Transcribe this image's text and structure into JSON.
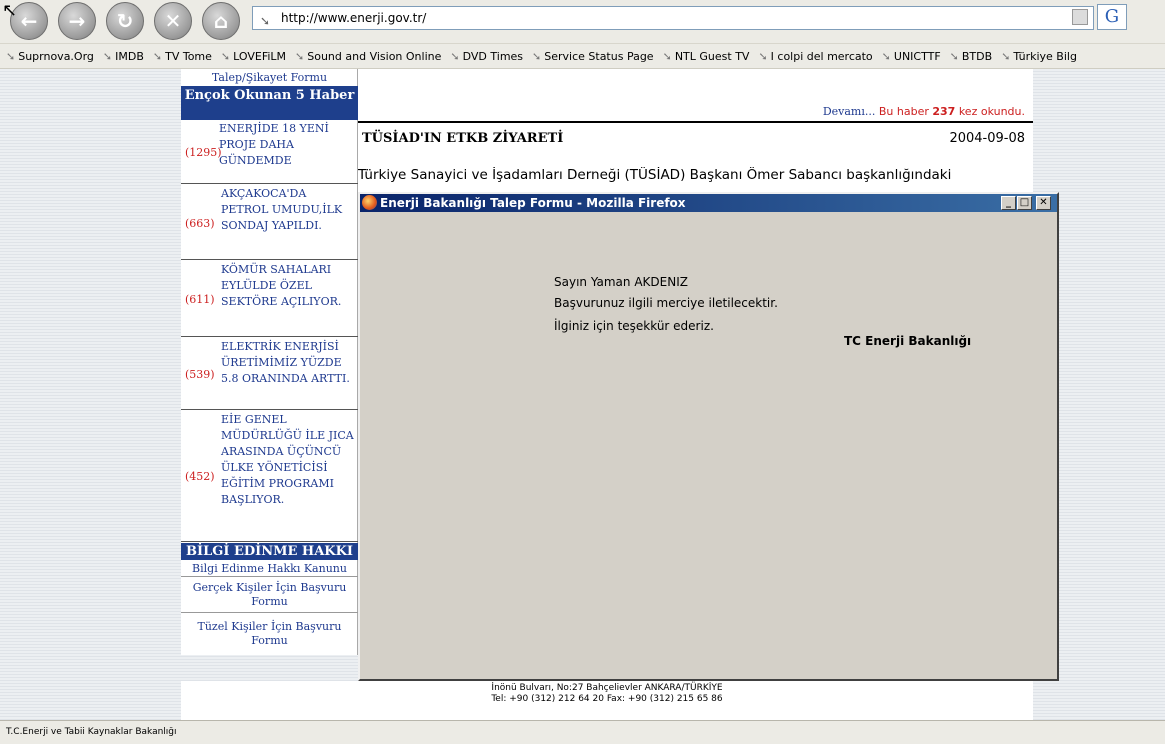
{
  "browser": {
    "url": "http://www.enerji.gov.tr/",
    "search_logo": "G",
    "bookmarks": [
      "Suprnova.Org",
      "IMDB",
      "TV Tome",
      "LOVEFiLM",
      "Sound and Vision Online",
      "DVD Times",
      "Service Status Page",
      "NTL Guest TV",
      "I colpi del mercato",
      "UNICTTF",
      "BTDB",
      "Türkiye Bilg"
    ]
  },
  "sidebar": {
    "talep_link": "Talep/Şikayet Formu",
    "top5_heading": "Ençok Okunan 5 Haber",
    "news": [
      {
        "count": "(1295)",
        "title": "ENERJİDE 18 YENİ PROJE DAHA GÜNDEMDE"
      },
      {
        "count": "(663)",
        "title": "AKÇAKOCA'DA PETROL UMUDU,İLK SONDAJ YAPILDI."
      },
      {
        "count": "(611)",
        "title": "KÖMÜR SAHALARI EYLÜLDE ÖZEL SEKTÖRE AÇILIYOR."
      },
      {
        "count": "(539)",
        "title": "ELEKTRİK ENERJİSİ ÜRETİMİMİZ YÜZDE 5.8 ORANINDA ARTTI."
      },
      {
        "count": "(452)",
        "title": "EİE GENEL MÜDÜRLÜĞÜ İLE JICA ARASINDA ÜÇÜNCÜ ÜLKE YÖNETİCİSİ EĞİTİM PROGRAMI BAŞLIYOR."
      }
    ],
    "bilgi_heading": "BİLGİ EDİNME HAKKI",
    "bilgi_links": [
      "Bilgi Edinme Hakkı Kanunu",
      "Gerçek Kişiler İçin Başvuru Formu",
      "Tüzel Kişiler İçin Başvuru Formu"
    ]
  },
  "main": {
    "devami": "Devamı...",
    "read_prefix": "Bu haber",
    "read_count": "237",
    "read_suffix": "kez okundu.",
    "news_title": "TÜSİAD'IN ETKB ZİYARETİ",
    "news_date": "2004-09-08",
    "news_text": "Türkiye Sanayici ve İşadamları Derneği (TÜSİAD) Başkanı Ömer Sabancı başkanlığındaki"
  },
  "popup": {
    "title": "Enerji Bakanlığı Talep Formu - Mozilla Firefox",
    "line1": "Sayın Yaman AKDENIZ",
    "line2": "Başvurunuz ilgili merciye iletilecektir.",
    "line3": "İlginiz için teşekkür ederiz.",
    "signature": "TC Enerji Bakanlığı"
  },
  "footer": {
    "line1": "İnönü Bulvarı, No:27  Bahçelievler  ANKARA/TÜRKİYE",
    "line2": "Tel: +90 (312) 212 64 20  Fax: +90 (312) 215 65 86"
  },
  "status": "T.C.Enerji ve Tabii Kaynaklar Bakanlığı",
  "colors": {
    "nav_blue": "#1e3f8c",
    "count_red": "#cc1f1f",
    "link_blue": "#1f3a8f",
    "titlebar": "#0a246a"
  }
}
